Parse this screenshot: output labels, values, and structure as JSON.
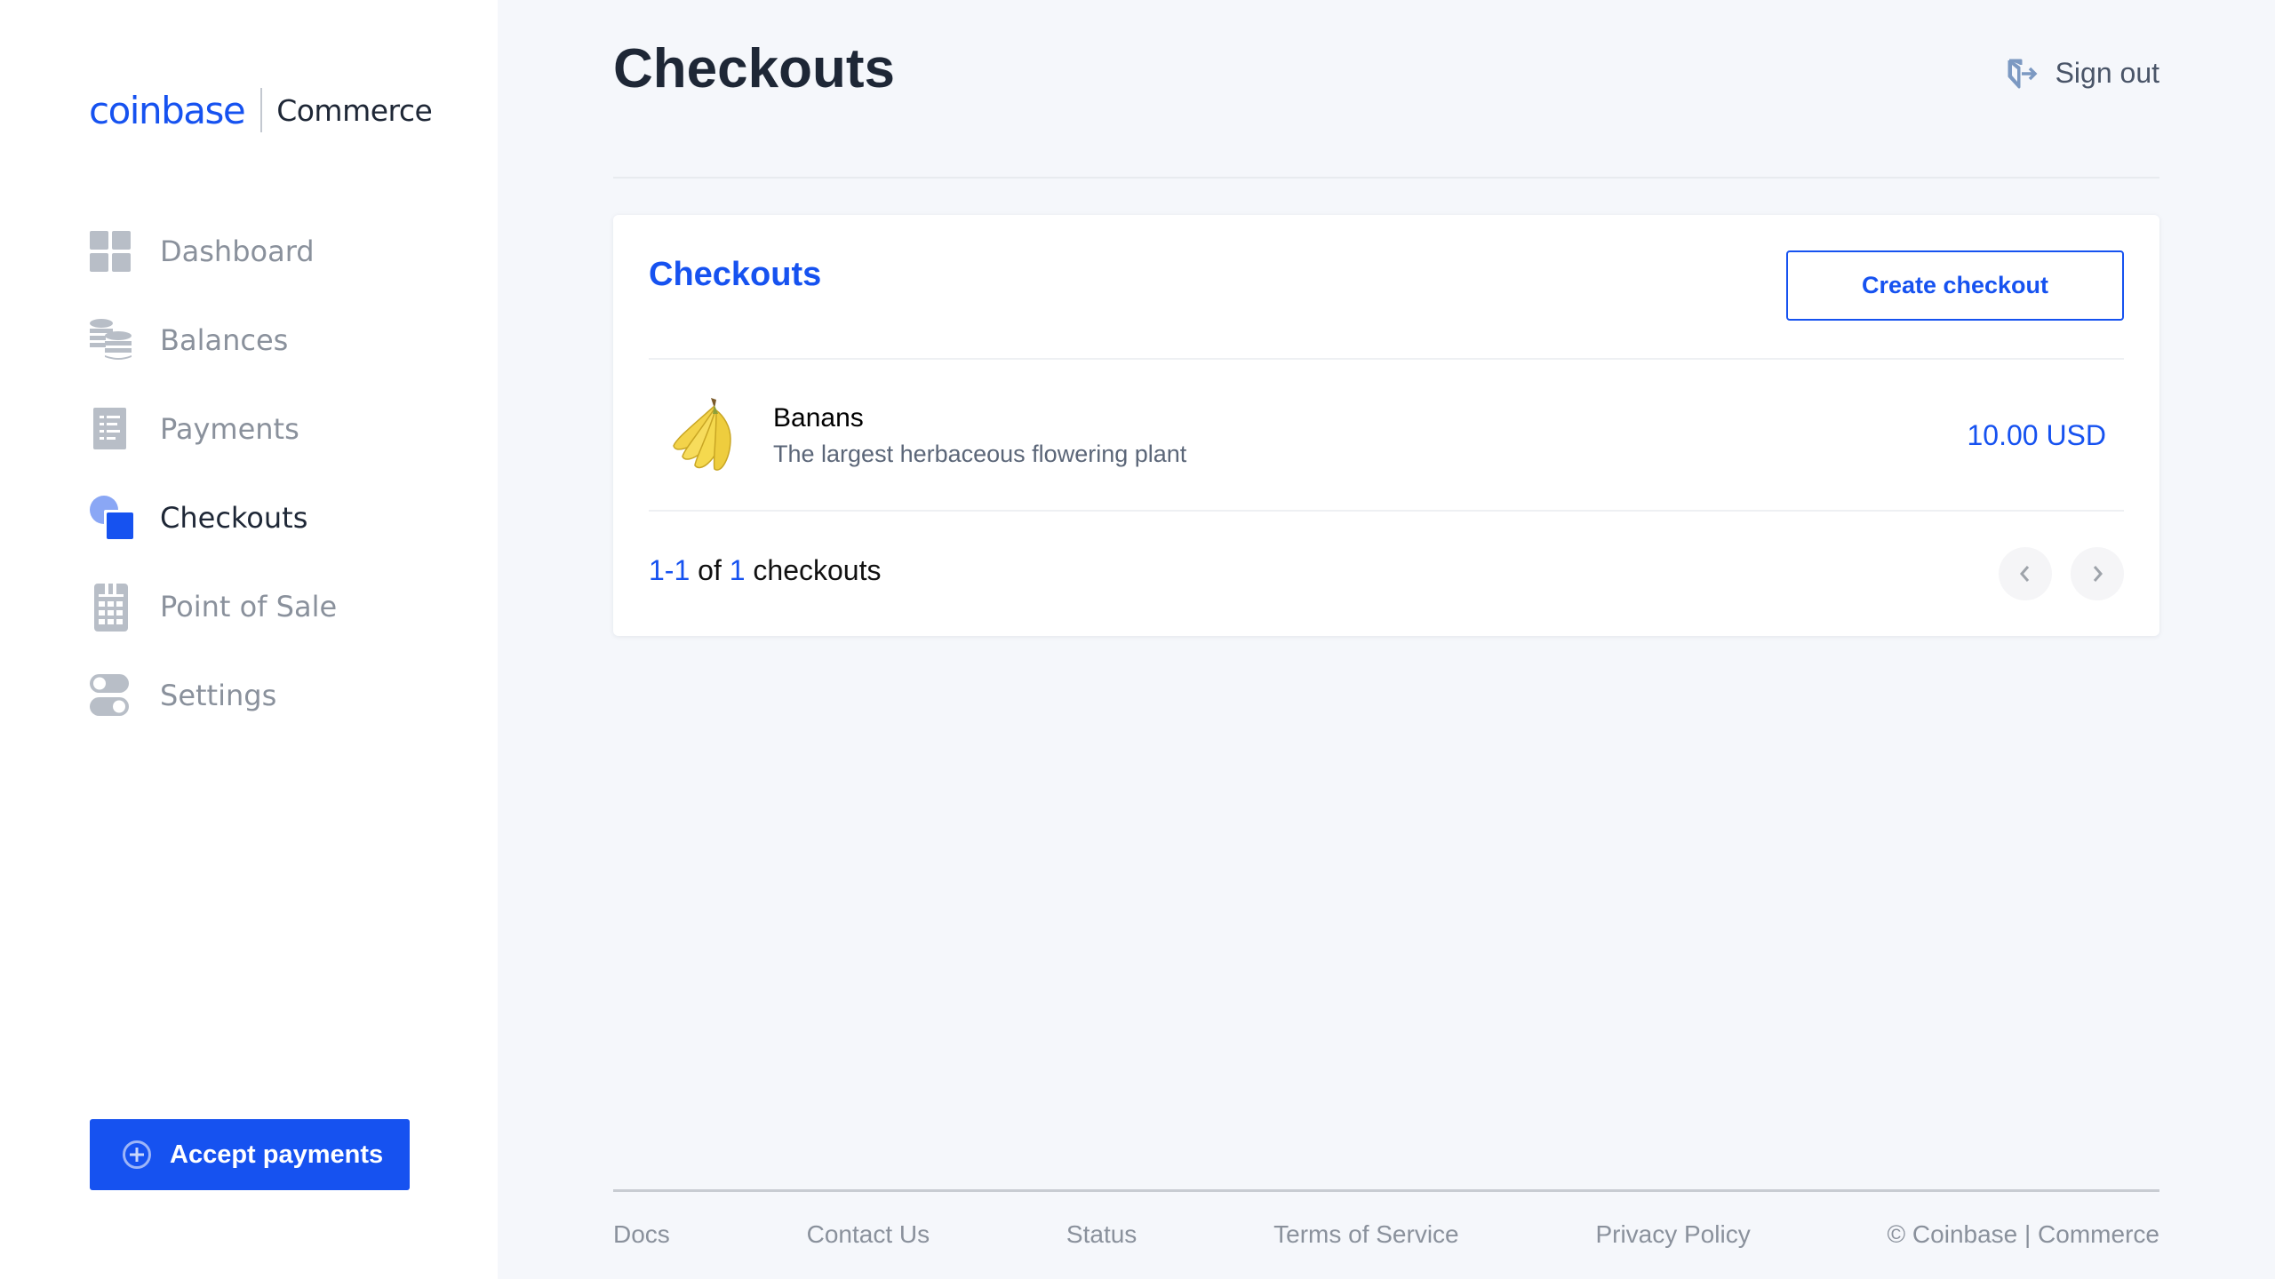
{
  "logo": {
    "brand": "coinbase",
    "product": "Commerce"
  },
  "sidebar": {
    "items": [
      {
        "label": "Dashboard",
        "icon": "dashboard-grid-icon",
        "active": false
      },
      {
        "label": "Balances",
        "icon": "coins-stack-icon",
        "active": false
      },
      {
        "label": "Payments",
        "icon": "receipt-list-icon",
        "active": false
      },
      {
        "label": "Checkouts",
        "icon": "checkouts-shapes-icon",
        "active": true
      },
      {
        "label": "Point of Sale",
        "icon": "pos-terminal-icon",
        "active": false
      },
      {
        "label": "Settings",
        "icon": "toggle-switches-icon",
        "active": false
      }
    ],
    "accept_payments_label": "Accept payments"
  },
  "header": {
    "title": "Checkouts",
    "sign_out_label": "Sign out"
  },
  "card": {
    "title": "Checkouts",
    "create_label": "Create checkout",
    "rows": [
      {
        "name": "Banans",
        "description": "The largest herbaceous flowering plant",
        "price": "10.00 USD",
        "image": "banana-bunch"
      }
    ],
    "pagination": {
      "range": "1-1",
      "of": "of",
      "total": "1",
      "suffix": "checkouts"
    }
  },
  "footer": {
    "links": [
      "Docs",
      "Contact Us",
      "Status",
      "Terms of Service",
      "Privacy Policy"
    ],
    "copyright": "© Coinbase | Commerce"
  },
  "colors": {
    "accent": "#1652f0",
    "sidebar_bg": "#ffffff",
    "main_bg": "#f5f7fb",
    "text_dark": "#1e2736",
    "text_muted": "#8a919c"
  }
}
